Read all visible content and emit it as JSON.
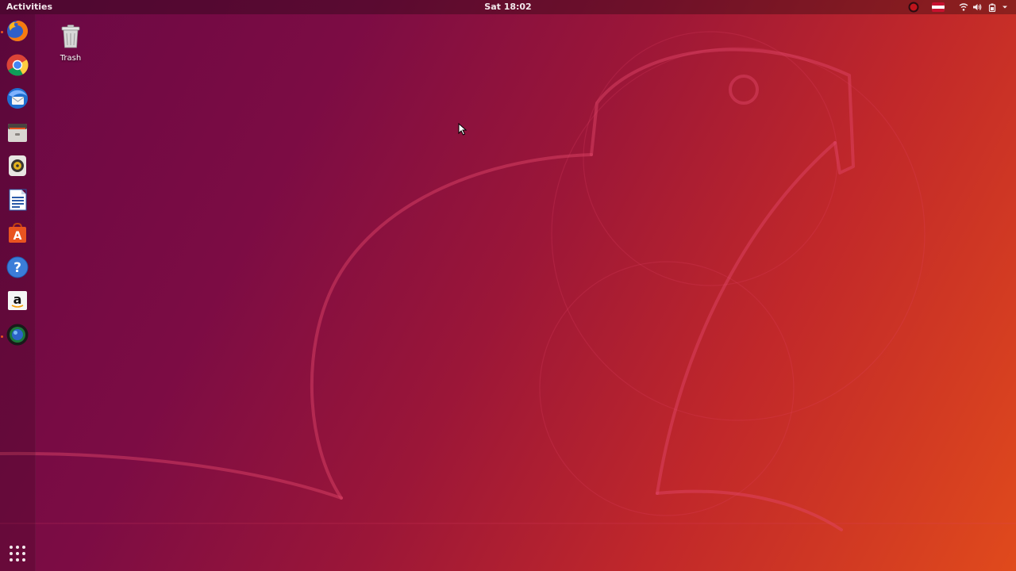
{
  "top_bar": {
    "activities_label": "Activities",
    "clock": "Sat 18:02",
    "tray_icons": [
      "recording-indicator-icon",
      "keyboard-layout-flag-icon",
      "wifi-icon",
      "volume-icon",
      "battery-icon",
      "system-menu-chevron-icon"
    ]
  },
  "dock": {
    "items": [
      {
        "name": "Firefox",
        "icon": "firefox-icon",
        "running": true
      },
      {
        "name": "Chrome",
        "icon": "chrome-icon",
        "running": false
      },
      {
        "name": "Thunderbird",
        "icon": "thunderbird-icon",
        "running": false
      },
      {
        "name": "Files",
        "icon": "files-icon",
        "running": false
      },
      {
        "name": "Rhythmbox",
        "icon": "rhythmbox-icon",
        "running": false
      },
      {
        "name": "LibreOffice Writer",
        "icon": "libreoffice-writer-icon",
        "running": false
      },
      {
        "name": "Ubuntu Software",
        "icon": "ubuntu-software-icon",
        "running": false
      },
      {
        "name": "Help",
        "icon": "help-icon",
        "running": false
      },
      {
        "name": "Amazon",
        "icon": "amazon-icon",
        "running": false
      },
      {
        "name": "Screen Recorder",
        "icon": "screen-recorder-icon",
        "running": true
      }
    ],
    "show_applications": "show-applications-grid-icon"
  },
  "desktop": {
    "icons": [
      {
        "label": "Trash",
        "icon": "trash-icon"
      }
    ]
  },
  "colors": {
    "accent": "#e95420",
    "wallpaper_start": "#6a0845",
    "wallpaper_end": "#e04a1c"
  }
}
